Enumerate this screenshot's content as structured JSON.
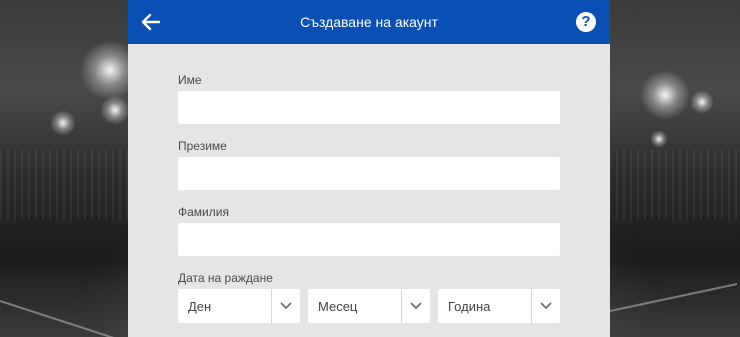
{
  "header": {
    "title": "Създаване на акаунт",
    "back_icon": "arrow-left-icon",
    "help_icon": "question-circle-icon",
    "help_glyph": "?"
  },
  "form": {
    "first_name": {
      "label": "Име",
      "value": ""
    },
    "middle_name": {
      "label": "Презиме",
      "value": ""
    },
    "last_name": {
      "label": "Фамилия",
      "value": ""
    },
    "birth_date": {
      "label": "Дата на раждане",
      "day": "Ден",
      "month": "Месец",
      "year": "Година"
    }
  },
  "colors": {
    "header_bg": "#0a4fb3",
    "panel_bg": "#e5e5e5",
    "field_bg": "#ffffff"
  }
}
